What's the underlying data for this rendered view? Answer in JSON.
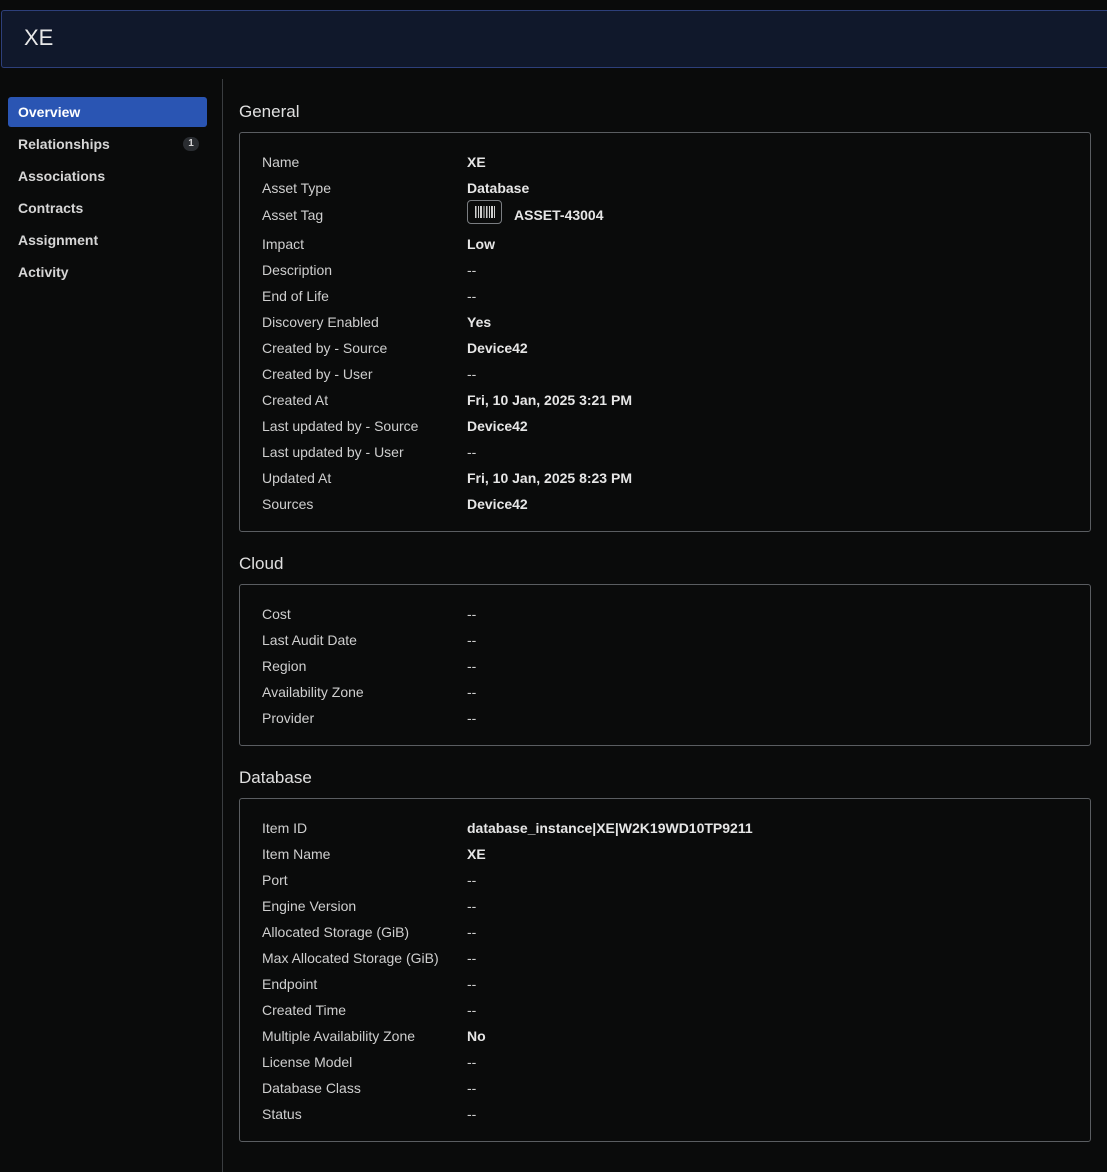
{
  "header": {
    "title": "XE"
  },
  "sidebar": {
    "items": [
      {
        "label": "Overview",
        "active": true
      },
      {
        "label": "Relationships",
        "badge": "1"
      },
      {
        "label": "Associations"
      },
      {
        "label": "Contracts"
      },
      {
        "label": "Assignment"
      },
      {
        "label": "Activity"
      }
    ]
  },
  "general": {
    "title": "General",
    "rows": [
      {
        "label": "Name",
        "value": "XE"
      },
      {
        "label": "Asset Type",
        "value": "Database"
      },
      {
        "label": "Asset Tag",
        "value": "ASSET-43004",
        "icon": "barcode-icon"
      },
      {
        "label": "Impact",
        "value": "Low"
      },
      {
        "label": "Description",
        "value": "--"
      },
      {
        "label": "End of Life",
        "value": "--"
      },
      {
        "label": "Discovery Enabled",
        "value": "Yes"
      },
      {
        "label": "Created by - Source",
        "value": "Device42"
      },
      {
        "label": "Created by - User",
        "value": "--"
      },
      {
        "label": "Created At",
        "value": "Fri, 10 Jan, 2025 3:21 PM"
      },
      {
        "label": "Last updated by - Source",
        "value": "Device42"
      },
      {
        "label": "Last updated by - User",
        "value": "--"
      },
      {
        "label": "Updated At",
        "value": "Fri, 10 Jan, 2025 8:23 PM"
      },
      {
        "label": "Sources",
        "value": "Device42"
      }
    ]
  },
  "cloud": {
    "title": "Cloud",
    "rows": [
      {
        "label": "Cost",
        "value": "--"
      },
      {
        "label": "Last Audit Date",
        "value": "--"
      },
      {
        "label": "Region",
        "value": "--"
      },
      {
        "label": "Availability Zone",
        "value": "--"
      },
      {
        "label": "Provider",
        "value": "--"
      }
    ]
  },
  "database": {
    "title": "Database",
    "rows": [
      {
        "label": "Item ID",
        "value": "database_instance|XE|W2K19WD10TP9211"
      },
      {
        "label": "Item Name",
        "value": "XE"
      },
      {
        "label": "Port",
        "value": "--"
      },
      {
        "label": "Engine Version",
        "value": "--"
      },
      {
        "label": "Allocated Storage (GiB)",
        "value": "--"
      },
      {
        "label": "Max Allocated Storage (GiB)",
        "value": "--"
      },
      {
        "label": "Endpoint",
        "value": "--"
      },
      {
        "label": "Created Time",
        "value": "--"
      },
      {
        "label": "Multiple Availability Zone",
        "value": "No"
      },
      {
        "label": "License Model",
        "value": "--"
      },
      {
        "label": "Database Class",
        "value": "--"
      },
      {
        "label": "Status",
        "value": "--"
      }
    ]
  }
}
